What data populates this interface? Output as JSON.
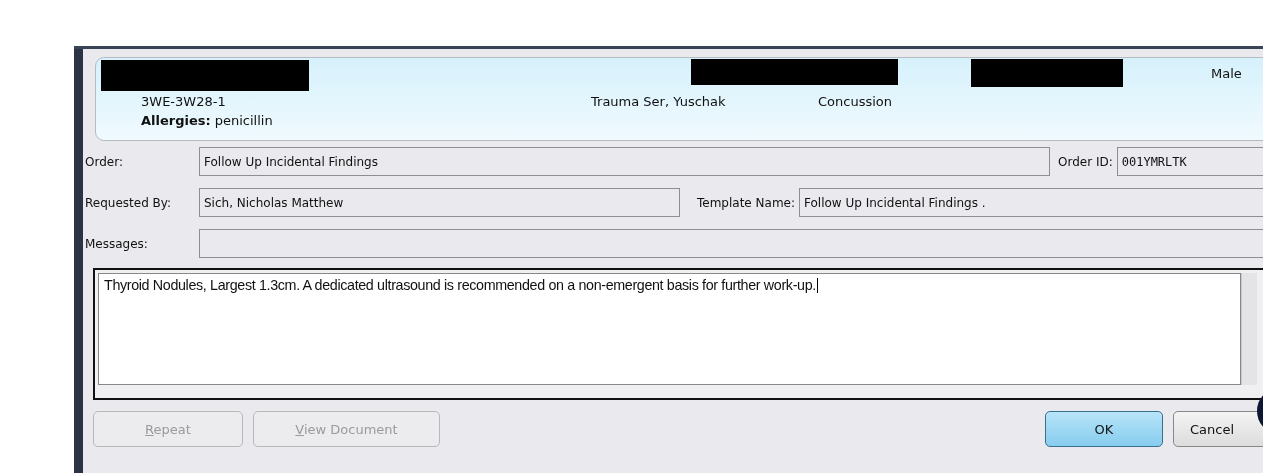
{
  "header": {
    "gender": "Male",
    "location": "3WE-3W28-1",
    "service": "Trauma Ser, Yuschak",
    "reason": "Concussion",
    "allergies_label": "Allergies:",
    "allergies": "penicillin"
  },
  "form": {
    "order_label": "Order:",
    "order": "Follow Up Incidental Findings",
    "order_id_label": "Order ID:",
    "order_id": "001YMRLTK",
    "requested_label": "Requested By:",
    "requested_by": "Sich, Nicholas Matthew",
    "template_label": "Template Name:",
    "template_name": "Follow Up Incidental Findings .",
    "messages_label": "Messages:"
  },
  "note": {
    "value": "Thyroid Nodules, Largest 1.3cm. A dedicated ultrasound is recommended on a non-emergent basis for further work-up."
  },
  "buttons": [
    {
      "label": "Repeat",
      "disabled": true,
      "default": false,
      "mnemonic": true
    },
    {
      "label": "View Document",
      "disabled": true,
      "default": false,
      "mnemonic": true
    },
    {
      "label": "OK",
      "disabled": false,
      "default": true,
      "mnemonic": false
    },
    {
      "label": "Cancel",
      "disabled": false,
      "default": false,
      "mnemonic": false
    }
  ]
}
